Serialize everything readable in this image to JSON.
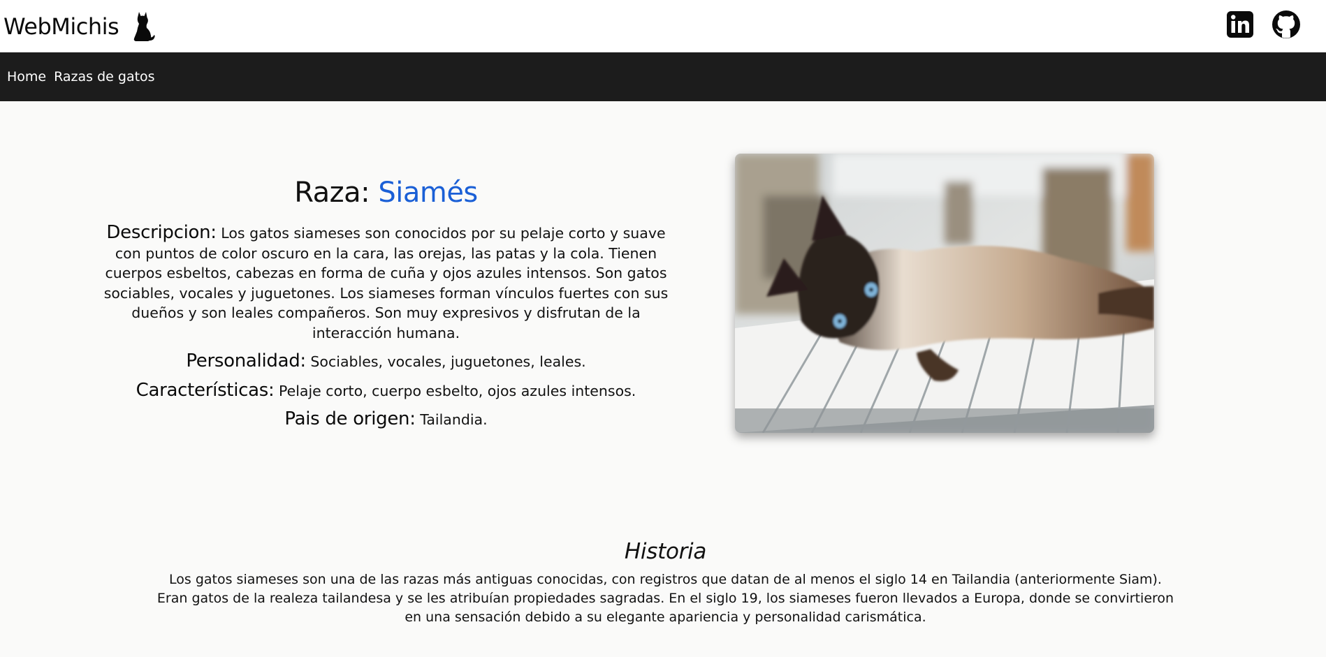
{
  "header": {
    "brand": "WebMichis",
    "logo_icon": "cat-silhouette-icon",
    "social": [
      {
        "name": "linkedin-icon"
      },
      {
        "name": "github-icon"
      }
    ]
  },
  "nav": {
    "items": [
      {
        "label": "Home"
      },
      {
        "label": "Razas de gatos"
      }
    ]
  },
  "breed": {
    "title_prefix": "Raza: ",
    "name": "Siamés",
    "accent_color": "#1a5fd6",
    "description_label": "Descripcion:",
    "description": " Los gatos siameses son conocidos por su pelaje corto y suave con puntos de color oscuro en la cara, las orejas, las patas y la cola. Tienen cuerpos esbeltos, cabezas en forma de cuña y ojos azules intensos. Son gatos sociables, vocales y juguetones. Los siameses forman vínculos fuertes con sus dueños y son leales compañeros. Son muy expresivos y disfrutan de la interacción humana.",
    "personality_label": "Personalidad:",
    "personality": " Sociables, vocales, juguetones, leales.",
    "traits_label": "Características:",
    "traits": " Pelaje corto, cuerpo esbelto, ojos azules intensos.",
    "origin_label": "Pais de origen:",
    "origin": " Tailandia."
  },
  "history": {
    "title": "Historia",
    "text": "Los gatos siameses son una de las razas más antiguas conocidas, con registros que datan de al menos el siglo 14 en Tailandia (anteriormente Siam). Eran gatos de la realeza tailandesa y se les atribuían propiedades sagradas. En el siglo 19, los siameses fueron llevados a Europa, donde se convirtieron en una sensación debido a su elegante apariencia y personalidad carismática."
  },
  "colors": {
    "navbar": "#1c1c1c",
    "page_background": "#fafaf9"
  }
}
